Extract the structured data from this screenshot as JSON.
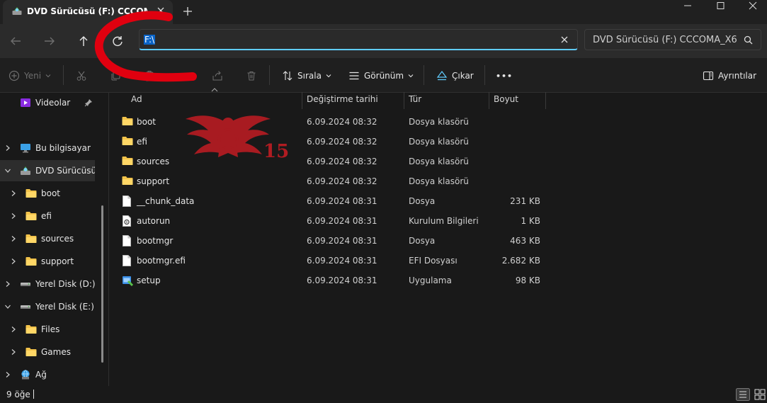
{
  "window": {
    "tab_title": "DVD Sürücüsü (F:) CCCOMA_X6",
    "new_tab": "+"
  },
  "nav": {
    "address_value": "F:\\",
    "search_placeholder": "DVD Sürücüsü (F:) CCCOMA_X6"
  },
  "toolbar": {
    "new_label": "Yeni",
    "sort_label": "Sırala",
    "view_label": "Görünüm",
    "eject_label": "Çıkar",
    "more_label": "•••",
    "details_label": "Ayrıntılar"
  },
  "sidebar": {
    "quick": [
      {
        "label": "Videolar",
        "icon": "videos-folder-icon"
      }
    ],
    "tree": [
      {
        "label": "Bu bilgisayar",
        "icon": "computer-icon",
        "level": 0,
        "expanded": false
      },
      {
        "label": "DVD Sürücüsü (F:)",
        "icon": "dvd-drive-icon",
        "level": 0,
        "expanded": true,
        "selected": true
      },
      {
        "label": "boot",
        "icon": "folder-icon",
        "level": 1,
        "expanded": false
      },
      {
        "label": "efi",
        "icon": "folder-icon",
        "level": 1,
        "expanded": false
      },
      {
        "label": "sources",
        "icon": "folder-icon",
        "level": 1,
        "expanded": false
      },
      {
        "label": "support",
        "icon": "folder-icon",
        "level": 1,
        "expanded": false
      },
      {
        "label": "Yerel Disk (D:)",
        "icon": "disk-icon",
        "level": 0,
        "expanded": false
      },
      {
        "label": "Yerel Disk (E:)",
        "icon": "disk-icon",
        "level": 0,
        "expanded": true
      },
      {
        "label": "Files",
        "icon": "folder-icon",
        "level": 1,
        "expanded": false
      },
      {
        "label": "Games",
        "icon": "folder-icon",
        "level": 1,
        "expanded": false
      },
      {
        "label": "Ağ",
        "icon": "network-icon",
        "level": 0,
        "expanded": false
      }
    ]
  },
  "columns": {
    "name": "Ad",
    "date": "Değiştirme tarihi",
    "type": "Tür",
    "size": "Boyut"
  },
  "files": [
    {
      "name": "boot",
      "date": "6.09.2024 08:32",
      "type": "Dosya klasörü",
      "size": "",
      "icon": "folder-icon"
    },
    {
      "name": "efi",
      "date": "6.09.2024 08:32",
      "type": "Dosya klasörü",
      "size": "",
      "icon": "folder-icon"
    },
    {
      "name": "sources",
      "date": "6.09.2024 08:32",
      "type": "Dosya klasörü",
      "size": "",
      "icon": "folder-icon"
    },
    {
      "name": "support",
      "date": "6.09.2024 08:32",
      "type": "Dosya klasörü",
      "size": "",
      "icon": "folder-icon"
    },
    {
      "name": "__chunk_data",
      "date": "6.09.2024 08:31",
      "type": "Dosya",
      "size": "231 KB",
      "icon": "file-icon"
    },
    {
      "name": "autorun",
      "date": "6.09.2024 08:31",
      "type": "Kurulum Bilgileri",
      "size": "1 KB",
      "icon": "settings-file-icon"
    },
    {
      "name": "bootmgr",
      "date": "6.09.2024 08:31",
      "type": "Dosya",
      "size": "463 KB",
      "icon": "file-icon"
    },
    {
      "name": "bootmgr.efi",
      "date": "6.09.2024 08:31",
      "type": "EFI Dosyası",
      "size": "2.682 KB",
      "icon": "file-icon"
    },
    {
      "name": "setup",
      "date": "6.09.2024 08:31",
      "type": "Uygulama",
      "size": "98 KB",
      "icon": "setup-app-icon"
    }
  ],
  "watermark": {
    "number": "15"
  },
  "status": {
    "item_count": "9 öğe"
  },
  "colors": {
    "accent": "#60cdff",
    "folder": "#f3c34a",
    "annotation": "#e0000f",
    "watermark": "#b01c22"
  }
}
